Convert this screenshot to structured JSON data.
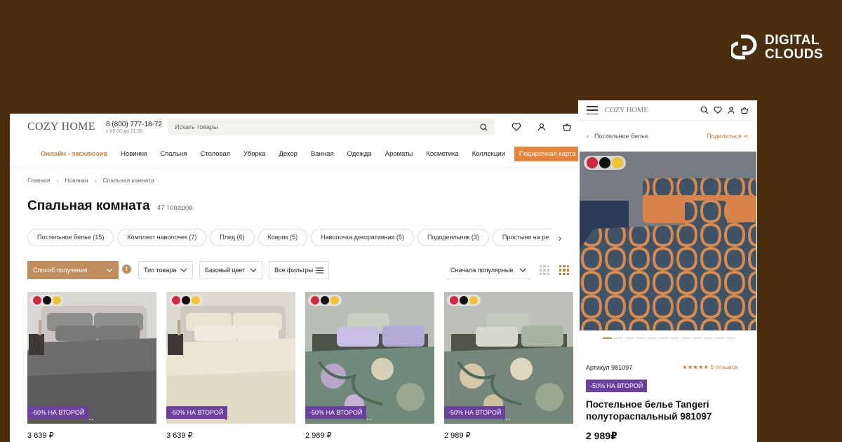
{
  "brand": {
    "line1": "DIGITAL",
    "line2": "CLOUDS",
    "color": "#ffffff",
    "background": "#4a2d0c"
  },
  "desktop": {
    "logo": "COZY HOME",
    "phone": "8 (800) 777-18-72",
    "hours": "с 09.00 до 21.00",
    "search_placeholder": "Искать товары",
    "nav": [
      "Онлайн - эксклюзив",
      "Новинки",
      "Спальня",
      "Столовая",
      "Уборка",
      "Декор",
      "Ванная",
      "Одежда",
      "Ароматы",
      "Косметика",
      "Коллекции"
    ],
    "gift_button": "Подарочная карта",
    "breadcrumbs": [
      "Главная",
      "Новинки",
      "Спальная комната"
    ],
    "page_title": "Спальная комната",
    "count": "47 товаров",
    "chips": [
      "Постельное белье (15)",
      "Комплект наволочек (7)",
      "Плед (6)",
      "Коврик (5)",
      "Наволочка декоративная (5)",
      "Пододеяльник (3)",
      "Простыня на ре"
    ],
    "filters": {
      "delivery": "Способ получения",
      "type": "Тип товара",
      "color": "Базовый цвет",
      "all": "Все фильтры",
      "sort": "Сначала популярные"
    },
    "products": [
      {
        "promo": "-50% НА ВТОРОЙ",
        "price": "3 639 ₽",
        "palette": "gray"
      },
      {
        "promo": "-50% НА ВТОРОЙ",
        "price": "3 639 ₽",
        "palette": "cream"
      },
      {
        "promo": "-50% НА ВТОРОЙ",
        "price": "2 989 ₽",
        "palette": "floral-lilac"
      },
      {
        "promo": "-50% НА ВТОРОЙ",
        "price": "2 989 ₽",
        "palette": "floral-beige"
      }
    ],
    "accent": "#c8813d",
    "promo_color": "#6b3fa0"
  },
  "mobile": {
    "logo": "COZY HOME",
    "back_label": "Постельное белье",
    "share_label": "Поделиться",
    "article": "Артикул 981097",
    "rating": "★★★★★  5 отзывов",
    "promo": "-50% НА ВТОРОЙ",
    "title": "Постельное белье Tangeri полутораспальный 981097",
    "price": "2 989₽"
  }
}
